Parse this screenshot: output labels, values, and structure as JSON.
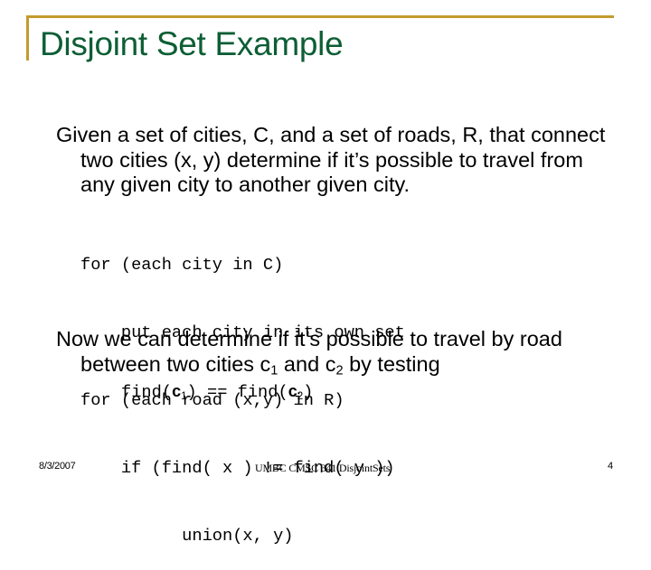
{
  "slide": {
    "title": "Disjoint Set Example",
    "accent_color": "#c39b2b",
    "title_color": "#0d5e35",
    "paragraph1": "Given a set of cities, C, and a set of roads, R, that connect two cities (x, y)  determine if it’s possible to travel from any given city to another given city.",
    "code_lines": [
      "for (each city in C)",
      "    put each city in its own set",
      "for (each road (x,y) in R)",
      "    if (find( x ) != find( y ))",
      "          union(x, y)"
    ],
    "paragraph2": {
      "before": "Now we can determine if it’s possible to travel by road between two cities ",
      "var1": "c",
      "sub1": "1",
      "middle": " and ",
      "var2": "c",
      "sub2": "2",
      "after": " by testing"
    },
    "test_expression": {
      "part1": "find(",
      "var1": "c",
      "sub1": "1",
      "part2": ") == find(",
      "var2": "c",
      "sub2": "2",
      "part3": ")"
    }
  },
  "footer": {
    "date": "8/3/2007",
    "center": "UMBC CMSC 341 DisjointSets",
    "page_number": "4"
  }
}
